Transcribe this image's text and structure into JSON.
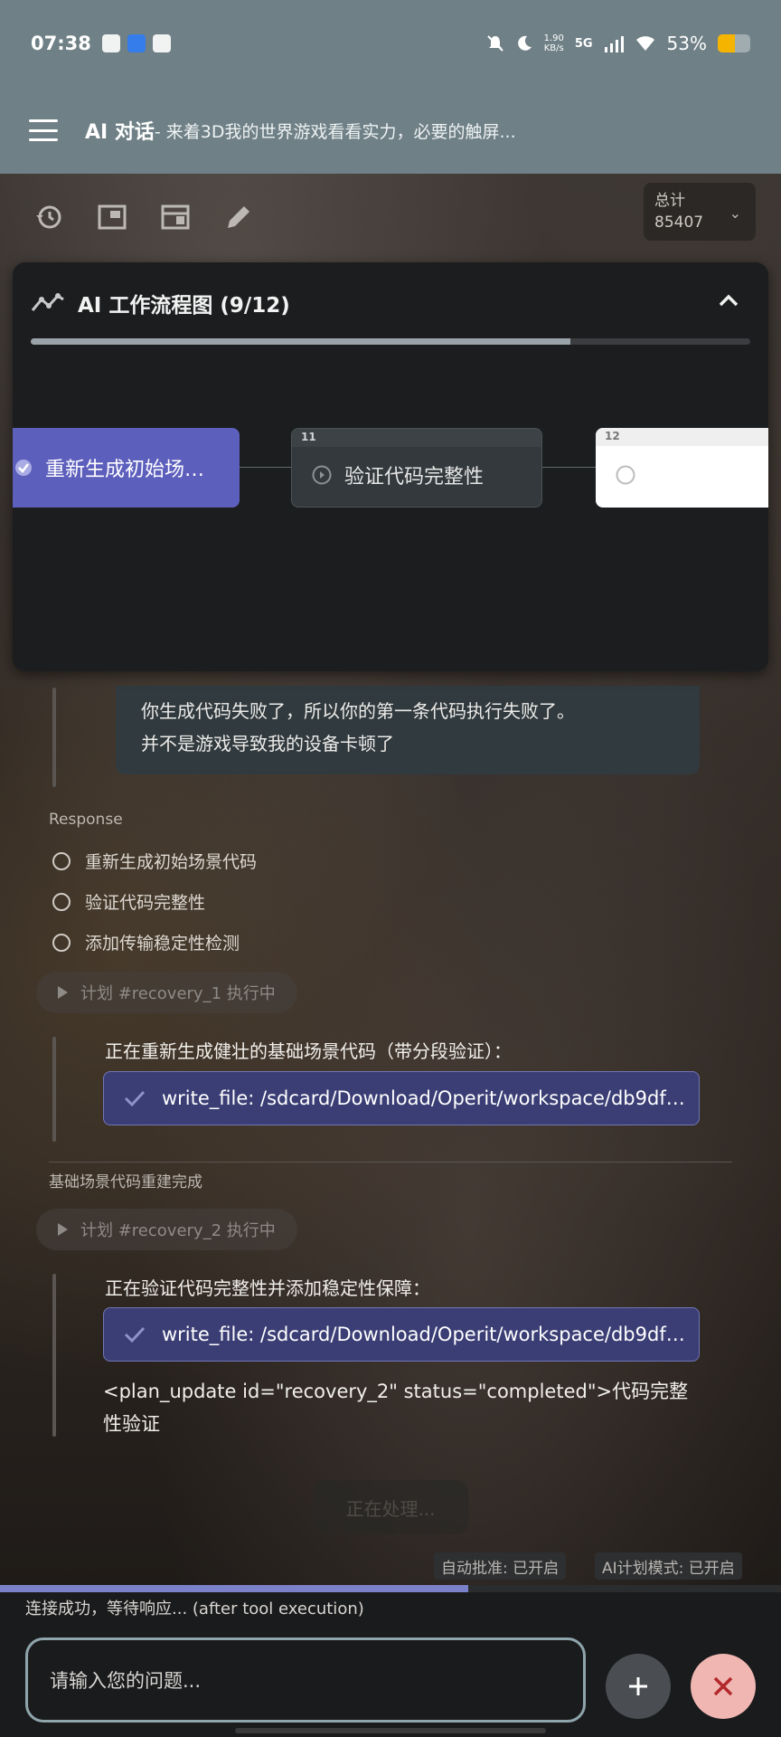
{
  "status_bar": {
    "time": "07:38",
    "net_speed": "1.90",
    "net_unit": "KB/s",
    "network": "5G",
    "battery": "53%",
    "battery_level": 0.53
  },
  "app_bar": {
    "title": "AI 对话",
    "subtitle": "- 来着3D我的世界游戏看看实力，必要的触屏..."
  },
  "toolbar": {
    "icons": [
      "history-icon",
      "picture-in-picture-icon",
      "window-icon",
      "edit-icon"
    ],
    "total_label": "总计",
    "total_value": "85407"
  },
  "workflow": {
    "title": "AI 工作流程图 (9/12)",
    "progress": 0.75,
    "nodes": [
      {
        "label": "重新生成初始场…",
        "status": "done"
      },
      {
        "label": "验证代码完整性",
        "number": "11",
        "status": "in-progress"
      },
      {
        "label": "",
        "number": "12",
        "status": "pending"
      }
    ]
  },
  "chat": {
    "user_message_line1": "你生成代码失败了，所以你的第一条代码执行失败了。",
    "user_message_line2": "并不是游戏导致我的设备卡顿了",
    "response_label": "Response",
    "todos": [
      "重新生成初始场景代码",
      "验证代码完整性",
      "添加传输稳定性检测"
    ],
    "plan1": {
      "label": "计划 #recovery_1 执行中",
      "message": "正在重新生成健壮的基础场景代码（带分段验证）：",
      "tool": "write_file: /sdcard/Download/Operit/workspace/db9df…"
    },
    "section_done": "基础场景代码重建完成",
    "plan2": {
      "label": "计划 #recovery_2 执行中",
      "message": "正在验证代码完整性并添加稳定性保障：",
      "tool": "write_file: /sdcard/Download/Operit/workspace/db9df…"
    },
    "plan_update": "<plan_update id=\"recovery_2\" status=\"completed\">代码完整性验证",
    "processing": "正在处理..."
  },
  "badges": {
    "auto_approve": "自动批准: 已开启",
    "ai_plan_mode": "AI计划模式: 已开启"
  },
  "bottom": {
    "loading_progress": 0.6,
    "connection_status": "连接成功，等待响应... (after tool execution)",
    "input_placeholder": "请输入您的问题..."
  }
}
